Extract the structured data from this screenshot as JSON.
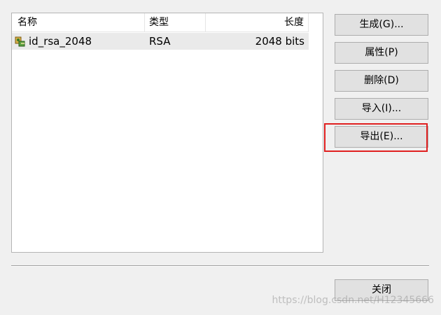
{
  "list": {
    "columns": [
      "名称",
      "类型",
      "长度"
    ],
    "rows": [
      {
        "name": "id_rsa_2048",
        "type": "RSA",
        "length": "2048 bits",
        "icon": "key-pair-icon"
      }
    ]
  },
  "buttons": {
    "generate": "生成(G)...",
    "properties": "属性(P)",
    "delete": "删除(D)",
    "import": "导入(I)...",
    "export": "导出(E)...",
    "close": "关闭"
  },
  "colors": {
    "highlight": "#e02020",
    "row_background": "#eaeaea",
    "button_face": "#e1e1e1"
  },
  "watermark": "https://blog.csdn.net/H12345666"
}
